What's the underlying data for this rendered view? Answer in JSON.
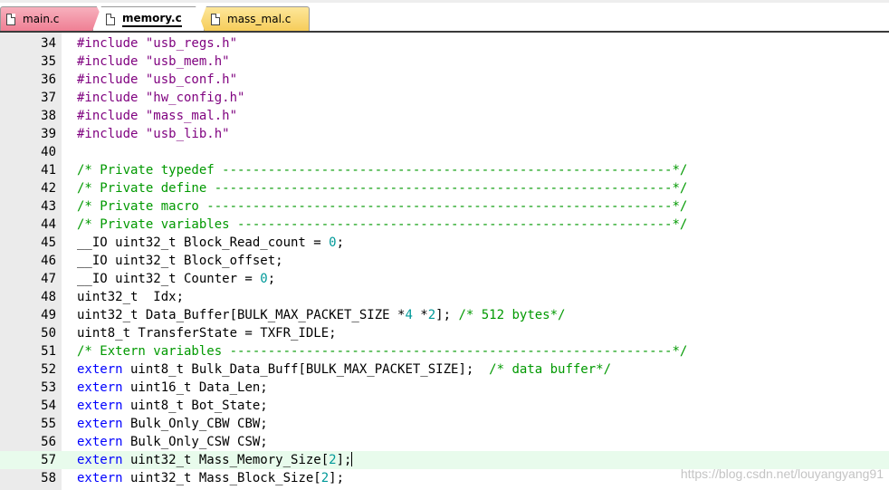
{
  "tabs": [
    {
      "label": "main.c",
      "active": false,
      "color": "#ef7f94"
    },
    {
      "label": "memory.c",
      "active": true,
      "color": "#ffffff"
    },
    {
      "label": "mass_mal.c",
      "active": false,
      "color": "#f6cd5a"
    }
  ],
  "editor": {
    "current_line": 57,
    "colors": {
      "keyword": "#0000ff",
      "preprocessor": "#7f007f",
      "string": "#7f007f",
      "comment": "#009900",
      "number": "#009999",
      "current_line_bg": "#e8fbec",
      "gutter_bg": "#ebebeb"
    },
    "lines": [
      {
        "n": "34",
        "tokens": [
          {
            "t": "pp",
            "v": "#include "
          },
          {
            "t": "str",
            "v": "\"usb_regs.h\""
          }
        ]
      },
      {
        "n": "35",
        "tokens": [
          {
            "t": "pp",
            "v": "#include "
          },
          {
            "t": "str",
            "v": "\"usb_mem.h\""
          }
        ]
      },
      {
        "n": "36",
        "tokens": [
          {
            "t": "pp",
            "v": "#include "
          },
          {
            "t": "str",
            "v": "\"usb_conf.h\""
          }
        ]
      },
      {
        "n": "37",
        "tokens": [
          {
            "t": "pp",
            "v": "#include "
          },
          {
            "t": "str",
            "v": "\"hw_config.h\""
          }
        ]
      },
      {
        "n": "38",
        "tokens": [
          {
            "t": "pp",
            "v": "#include "
          },
          {
            "t": "str",
            "v": "\"mass_mal.h\""
          }
        ]
      },
      {
        "n": "39",
        "tokens": [
          {
            "t": "pp",
            "v": "#include "
          },
          {
            "t": "str",
            "v": "\"usb_lib.h\""
          }
        ]
      },
      {
        "n": "40",
        "tokens": []
      },
      {
        "n": "41",
        "tokens": [
          {
            "t": "cm",
            "v": "/* Private typedef -----------------------------------------------------------*/"
          }
        ]
      },
      {
        "n": "42",
        "tokens": [
          {
            "t": "cm",
            "v": "/* Private define ------------------------------------------------------------*/"
          }
        ]
      },
      {
        "n": "43",
        "tokens": [
          {
            "t": "cm",
            "v": "/* Private macro -------------------------------------------------------------*/"
          }
        ]
      },
      {
        "n": "44",
        "tokens": [
          {
            "t": "cm",
            "v": "/* Private variables ---------------------------------------------------------*/"
          }
        ]
      },
      {
        "n": "45",
        "tokens": [
          {
            "t": "txt",
            "v": "__IO uint32_t Block_Read_count = "
          },
          {
            "t": "num",
            "v": "0"
          },
          {
            "t": "txt",
            "v": ";"
          }
        ]
      },
      {
        "n": "46",
        "tokens": [
          {
            "t": "txt",
            "v": "__IO uint32_t Block_offset;"
          }
        ]
      },
      {
        "n": "47",
        "tokens": [
          {
            "t": "txt",
            "v": "__IO uint32_t Counter = "
          },
          {
            "t": "num",
            "v": "0"
          },
          {
            "t": "txt",
            "v": ";"
          }
        ]
      },
      {
        "n": "48",
        "tokens": [
          {
            "t": "txt",
            "v": "uint32_t  Idx;"
          }
        ]
      },
      {
        "n": "49",
        "tokens": [
          {
            "t": "txt",
            "v": "uint32_t Data_Buffer[BULK_MAX_PACKET_SIZE *"
          },
          {
            "t": "num",
            "v": "4"
          },
          {
            "t": "txt",
            "v": " *"
          },
          {
            "t": "num",
            "v": "2"
          },
          {
            "t": "txt",
            "v": "]; "
          },
          {
            "t": "cm",
            "v": "/* 512 bytes*/"
          }
        ]
      },
      {
        "n": "50",
        "tokens": [
          {
            "t": "txt",
            "v": "uint8_t TransferState = TXFR_IDLE;"
          }
        ]
      },
      {
        "n": "51",
        "tokens": [
          {
            "t": "cm",
            "v": "/* Extern variables ----------------------------------------------------------*/"
          }
        ]
      },
      {
        "n": "52",
        "tokens": [
          {
            "t": "kw",
            "v": "extern"
          },
          {
            "t": "txt",
            "v": " uint8_t Bulk_Data_Buff[BULK_MAX_PACKET_SIZE];  "
          },
          {
            "t": "cm",
            "v": "/* data buffer*/"
          }
        ]
      },
      {
        "n": "53",
        "tokens": [
          {
            "t": "kw",
            "v": "extern"
          },
          {
            "t": "txt",
            "v": " uint16_t Data_Len;"
          }
        ]
      },
      {
        "n": "54",
        "tokens": [
          {
            "t": "kw",
            "v": "extern"
          },
          {
            "t": "txt",
            "v": " uint8_t Bot_State;"
          }
        ]
      },
      {
        "n": "55",
        "tokens": [
          {
            "t": "kw",
            "v": "extern"
          },
          {
            "t": "txt",
            "v": " Bulk_Only_CBW CBW;"
          }
        ]
      },
      {
        "n": "56",
        "tokens": [
          {
            "t": "kw",
            "v": "extern"
          },
          {
            "t": "txt",
            "v": " Bulk_Only_CSW CSW;"
          }
        ]
      },
      {
        "n": "57",
        "tokens": [
          {
            "t": "kw",
            "v": "extern"
          },
          {
            "t": "txt",
            "v": " uint32_t Mass_Memory_Size["
          },
          {
            "t": "num",
            "v": "2"
          },
          {
            "t": "txt",
            "v": "];"
          }
        ]
      },
      {
        "n": "58",
        "tokens": [
          {
            "t": "kw",
            "v": "extern"
          },
          {
            "t": "txt",
            "v": " uint32_t Mass_Block_Size["
          },
          {
            "t": "num",
            "v": "2"
          },
          {
            "t": "txt",
            "v": "];"
          }
        ]
      }
    ]
  },
  "watermark": "https://blog.csdn.net/louyangyang91"
}
